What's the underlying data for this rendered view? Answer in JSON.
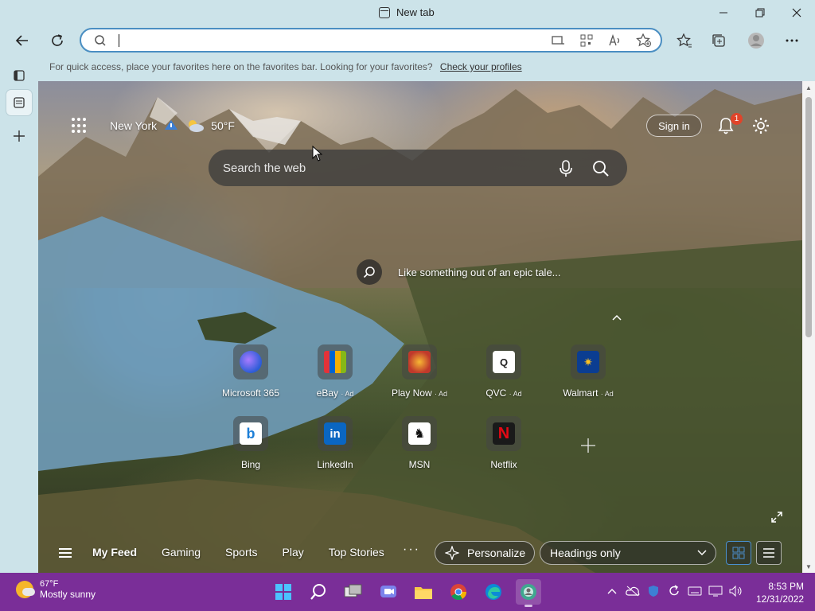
{
  "window": {
    "tab_title": "New tab",
    "controls": {
      "minimize": "—",
      "maximize": "❐",
      "close": "✕"
    }
  },
  "favorites_bar": {
    "message": "For quick access, place your favorites here on the favorites bar. Looking for your favorites?",
    "link": "Check your profiles"
  },
  "newtab": {
    "location": "New York",
    "temperature": "50°F",
    "sign_in": "Sign in",
    "notification_count": "1",
    "search_placeholder": "Search the web",
    "image_caption": "Like something out of an epic tale...",
    "tiles": [
      {
        "label": "Microsoft 365",
        "ad": "",
        "icon": "microsoft365-icon",
        "color": "#7b61ff"
      },
      {
        "label": "eBay",
        "ad": "· Ad",
        "icon": "ebay-icon",
        "color": "#3a3a3a"
      },
      {
        "label": "Play Now",
        "ad": "· Ad",
        "icon": "play-now-icon",
        "color": "#c0392b"
      },
      {
        "label": "QVC",
        "ad": "· Ad",
        "icon": "qvc-icon",
        "color": "#ffffff"
      },
      {
        "label": "Walmart",
        "ad": "· Ad",
        "icon": "walmart-icon",
        "color": "#0b3d91"
      },
      {
        "label": "Bing",
        "ad": "",
        "icon": "bing-icon",
        "color": "#ffffff"
      },
      {
        "label": "LinkedIn",
        "ad": "",
        "icon": "linkedin-icon",
        "color": "#0a66c2"
      },
      {
        "label": "MSN",
        "ad": "",
        "icon": "msn-icon",
        "color": "#ffffff"
      },
      {
        "label": "Netflix",
        "ad": "",
        "icon": "netflix-icon",
        "color": "#e50914"
      }
    ],
    "feed_tabs": [
      "My Feed",
      "Gaming",
      "Sports",
      "Play",
      "Top Stories"
    ],
    "more": "···",
    "personalize": "Personalize",
    "layout_select": "Headings only"
  },
  "taskbar": {
    "weather_temp": "67°F",
    "weather_desc": "Mostly sunny",
    "time": "8:53 PM",
    "date": "12/31/2022"
  }
}
